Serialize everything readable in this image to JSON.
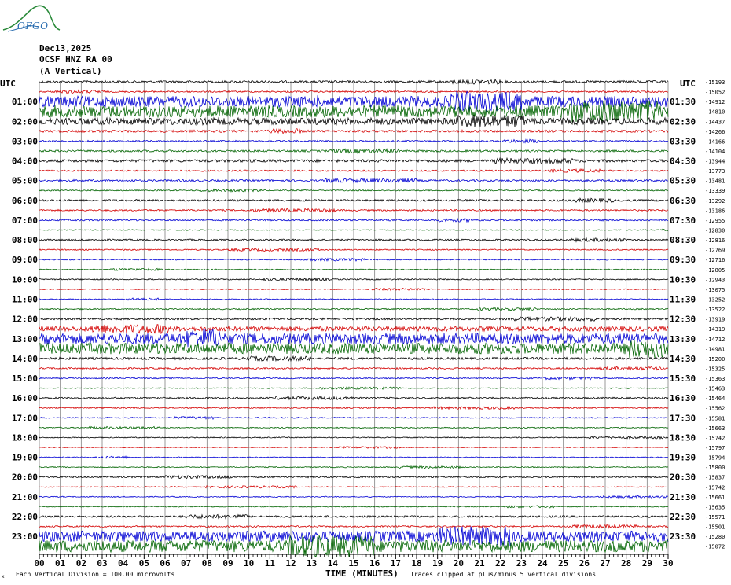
{
  "header": {
    "date": "Dec13,2025",
    "station": "OCSF HNZ RA 00",
    "component": "(A Vertical)",
    "logo_text": "OFGO"
  },
  "footer": {
    "left_note": "Each Vertical Division = 100.00 microvolts",
    "right_note": "Traces clipped at plus/minus 5 vertical divisions",
    "corner_mark": "x"
  },
  "colors": {
    "trace_cycle": [
      "#000000",
      "#d40000",
      "#0000d4",
      "#006400"
    ],
    "grid": "#808080",
    "logo": "#2a8a3a"
  },
  "chart_data": {
    "type": "line",
    "title": "",
    "xlabel": "TIME (MINUTES)",
    "ylabel": "",
    "x_ticks": [
      "00",
      "01",
      "02",
      "03",
      "04",
      "05",
      "06",
      "07",
      "08",
      "09",
      "10",
      "11",
      "12",
      "13",
      "14",
      "15",
      "16",
      "17",
      "18",
      "19",
      "20",
      "21",
      "22",
      "23",
      "24",
      "25",
      "26",
      "27",
      "28",
      "29",
      "30"
    ],
    "xlim": [
      0,
      30
    ],
    "left_axis_title": "UTC",
    "right_axis_title": "UTC",
    "left_labels": [
      "",
      "01:00",
      "02:00",
      "03:00",
      "04:00",
      "05:00",
      "06:00",
      "07:00",
      "08:00",
      "09:00",
      "10:00",
      "11:00",
      "12:00",
      "13:00",
      "14:00",
      "15:00",
      "16:00",
      "17:00",
      "18:00",
      "19:00",
      "20:00",
      "21:00",
      "22:00",
      "23:00"
    ],
    "right_labels": [
      "",
      "01:30",
      "02:30",
      "03:30",
      "04:30",
      "05:30",
      "06:30",
      "07:30",
      "08:30",
      "09:30",
      "10:30",
      "11:30",
      "12:30",
      "13:30",
      "14:30",
      "15:30",
      "16:30",
      "17:30",
      "18:30",
      "19:30",
      "20:30",
      "21:30",
      "22:30",
      "23:30"
    ],
    "trace_offsets": [
      "-15193",
      "-15052",
      "-14912",
      "-14810",
      "-14437",
      "-14266",
      "-14166",
      "-14104",
      "-13944",
      "-13773",
      "-13481",
      "-13339",
      "-13292",
      "-13186",
      "-12955",
      "-12830",
      "-12816",
      "-12769",
      "-12716",
      "-12805",
      "-12943",
      "-13075",
      "-13252",
      "-13522",
      "-13919",
      "-14319",
      "-14712",
      "-14981",
      "-15200",
      "-15325",
      "-15363",
      "-15463",
      "-15464",
      "-15562",
      "-15581",
      "-15663",
      "-15742",
      "-15797",
      "-15794",
      "-15800",
      "-15837",
      "-15742",
      "-15661",
      "-15635",
      "-15571",
      "-15501",
      "-15280",
      "-15072"
    ],
    "trace_amplitude": [
      0.12,
      0.08,
      0.55,
      0.6,
      0.35,
      0.12,
      0.08,
      0.1,
      0.14,
      0.08,
      0.1,
      0.06,
      0.1,
      0.08,
      0.08,
      0.05,
      0.08,
      0.06,
      0.06,
      0.05,
      0.06,
      0.05,
      0.05,
      0.06,
      0.1,
      0.25,
      0.55,
      0.55,
      0.12,
      0.08,
      0.06,
      0.05,
      0.08,
      0.06,
      0.06,
      0.05,
      0.05,
      0.04,
      0.05,
      0.05,
      0.08,
      0.05,
      0.05,
      0.05,
      0.1,
      0.08,
      0.55,
      0.6
    ],
    "trace_count": 48
  }
}
